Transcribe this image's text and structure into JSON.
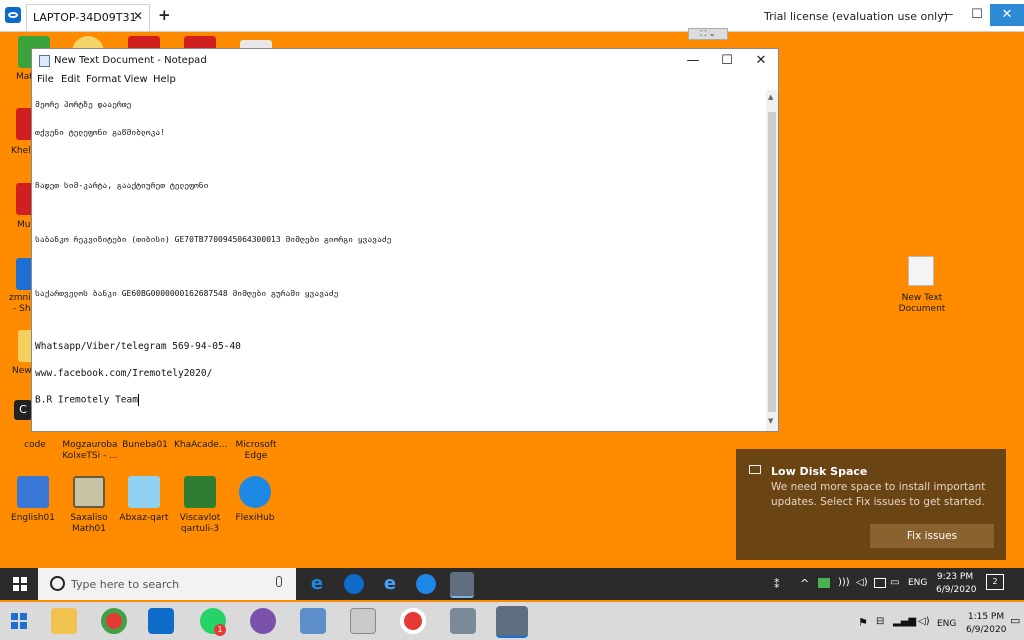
{
  "teamviewer": {
    "tab_label": "LAPTOP-34D09T31",
    "close_glyph": "✕",
    "new_tab_glyph": "+",
    "trial_text": "Trial license (evaluation use only)",
    "minimize": "—",
    "maximize": "☐",
    "close": "✕",
    "toolbar_toggle": "⛶ ⌄"
  },
  "desktop": {
    "left_fragments": [
      "Mat",
      "Khelo",
      "Mu",
      "zmni",
      "- Sh",
      "New",
      "C"
    ],
    "row1": [
      {
        "label": "code"
      },
      {
        "label": "Mogzauroba KolxeTSi - ..."
      },
      {
        "label": "Buneba01"
      },
      {
        "label": "KhaAcade..."
      },
      {
        "label": "Microsoft Edge"
      }
    ],
    "row2": [
      {
        "label": "English01"
      },
      {
        "label": "Saxaliso Math01"
      },
      {
        "label": "Abxaz-qart"
      },
      {
        "label": "Viscavlot qartuli-3"
      },
      {
        "label": "FlexiHub"
      }
    ],
    "new_text_doc": "New Text Document"
  },
  "notepad": {
    "title": "New Text Document - Notepad",
    "menu": [
      "File",
      "Edit",
      "Format",
      "View",
      "Help"
    ],
    "lines": [
      "მეორე პორტზე დააერთე",
      "თქვენი ტელეფონი გაწმიბლოკა!",
      "ჩადეთ სიმ-კარტა, გააქტიურეთ ტელეფონი",
      "საბანკო რეკვიზიტები (თიბისი) GE70TB7700945064300013 მიმღები გიორგი ყვავაძე",
      "საქართველოს ბანკი GE60BG0000000162687548 მიმღები გურამი ყვავაძე",
      "Whatsapp/Viber/telegram 569-94-05-40",
      "www.facebook.com/Iremotely2020/",
      "B.R Iremotely Team"
    ]
  },
  "toast": {
    "title": "Low Disk Space",
    "body": "We need more space to install important updates. Select Fix issues to get started.",
    "button": "Fix issues"
  },
  "remote_taskbar": {
    "search_placeholder": "Type here to search",
    "lang": "ENG",
    "time": "9:23 PM",
    "date": "6/9/2020",
    "notif_count": "2"
  },
  "local_taskbar": {
    "lang": "ENG",
    "time": "1:15 PM",
    "date": "6/9/2020",
    "whatsapp_badge": "1"
  },
  "colors": {
    "desktop_bg": "#ff8c00",
    "toast_bg": "#6b4414",
    "accent": "#0e6bc7"
  }
}
